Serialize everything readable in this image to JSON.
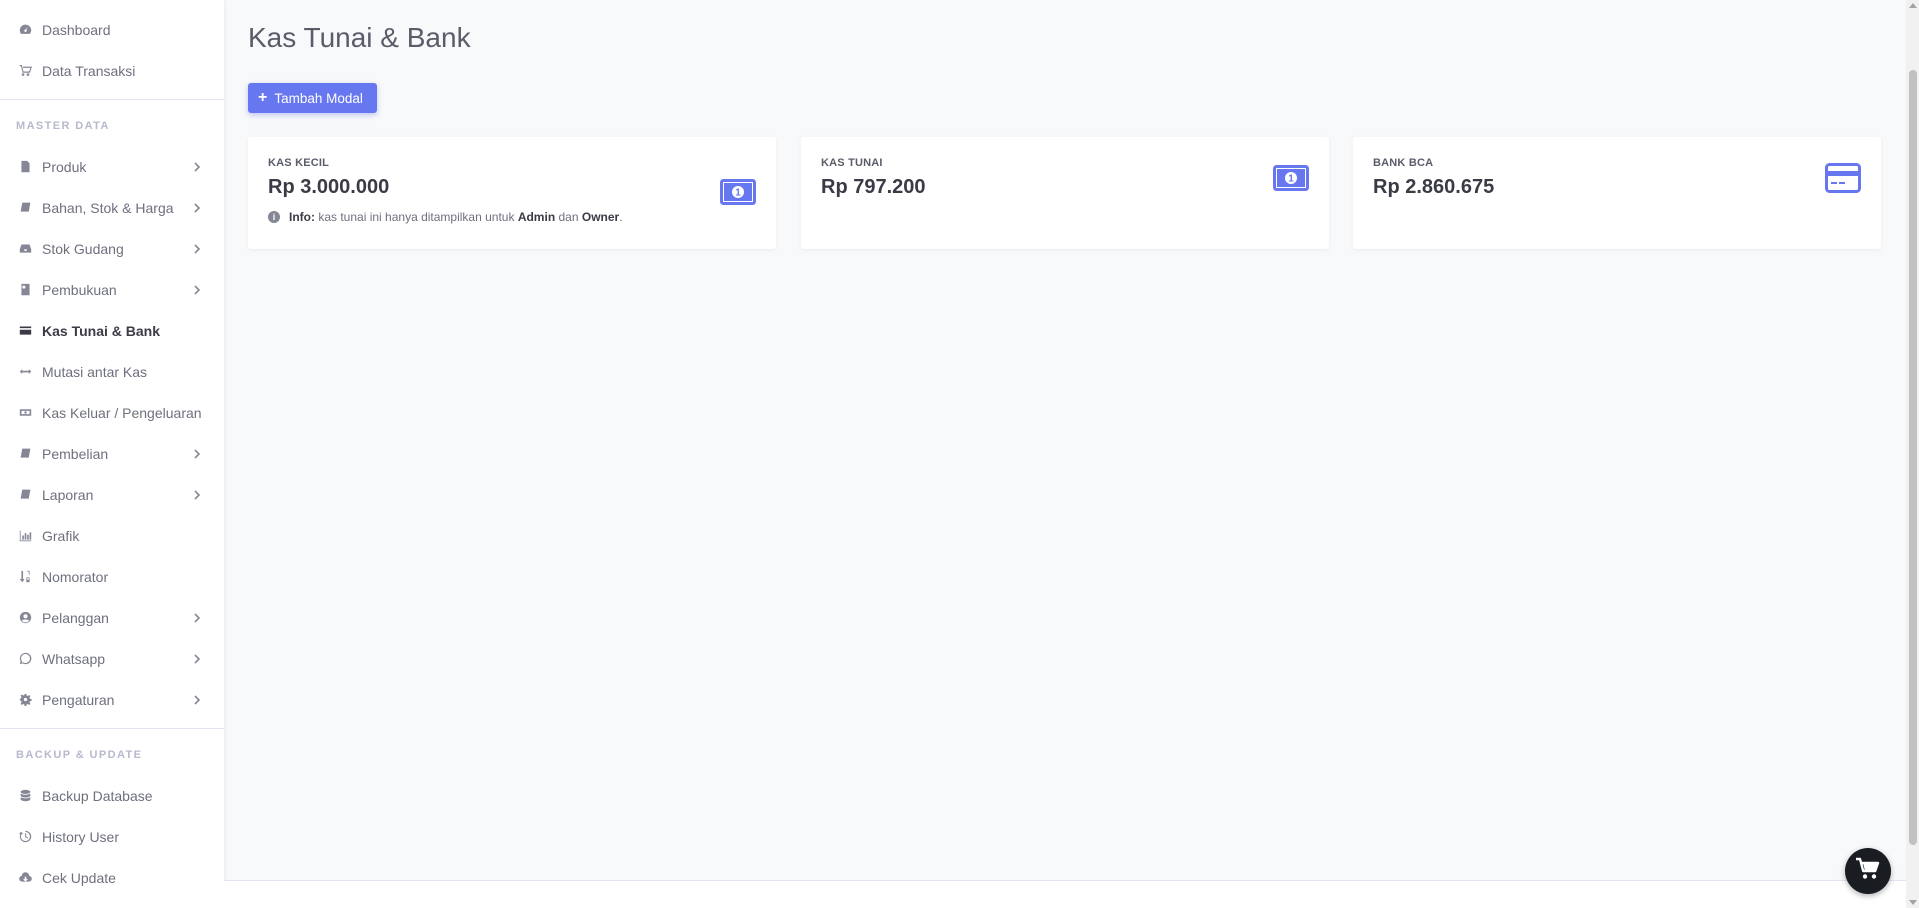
{
  "sidebar": {
    "top_items": [
      {
        "label": "Dashboard",
        "icon": "dashboard-icon"
      },
      {
        "label": "Data Transaksi",
        "icon": "cart-icon"
      }
    ],
    "master_heading": "MASTER DATA",
    "master_items": [
      {
        "label": "Produk",
        "icon": "file-icon",
        "has_sub": true
      },
      {
        "label": "Bahan, Stok & Harga",
        "icon": "book-icon",
        "has_sub": true
      },
      {
        "label": "Stok Gudang",
        "icon": "inbox-icon",
        "has_sub": true
      },
      {
        "label": "Pembukuan",
        "icon": "address-book-icon",
        "has_sub": true
      },
      {
        "label": "Kas Tunai & Bank",
        "icon": "credit-card-icon",
        "active": true
      },
      {
        "label": "Mutasi antar Kas",
        "icon": "arrows-h-icon"
      },
      {
        "label": "Kas Keluar / Pengeluaran",
        "icon": "money-icon"
      },
      {
        "label": "Pembelian",
        "icon": "book-icon",
        "has_sub": true
      },
      {
        "label": "Laporan",
        "icon": "book-icon",
        "has_sub": true
      },
      {
        "label": "Grafik",
        "icon": "bar-chart-icon"
      },
      {
        "label": "Nomorator",
        "icon": "sort-numeric-icon"
      },
      {
        "label": "Pelanggan",
        "icon": "user-circle-icon",
        "has_sub": true
      },
      {
        "label": "Whatsapp",
        "icon": "whatsapp-icon",
        "has_sub": true
      },
      {
        "label": "Pengaturan",
        "icon": "gear-icon",
        "has_sub": true
      }
    ],
    "backup_heading": "BACKUP & UPDATE",
    "backup_items": [
      {
        "label": "Backup Database",
        "icon": "database-icon"
      },
      {
        "label": "History User",
        "icon": "history-icon"
      },
      {
        "label": "Cek Update",
        "icon": "cloud-download-icon"
      }
    ]
  },
  "main": {
    "title": "Kas Tunai & Bank",
    "add_button": "Tambah Modal",
    "cards": [
      {
        "label": "KAS KECIL",
        "amount": "Rp 3.000.000",
        "icon": "money-bill-icon"
      },
      {
        "label": "KAS TUNAI",
        "amount": "Rp 797.200",
        "icon": "money-bill-icon"
      },
      {
        "label": "BANK BCA",
        "amount": "Rp 2.860.675",
        "icon": "credit-card-icon"
      }
    ],
    "info": {
      "prefix": "Info:",
      "text1": "kas tunai ini hanya ditampilkan untuk",
      "role1": "Admin",
      "text2": "dan",
      "role2": "Owner",
      "suffix": "."
    }
  },
  "colors": {
    "accent": "#6777ef",
    "sidebar_bg": "#ffffff",
    "content_bg": "#f8f9fa",
    "fab_bg": "#191d21"
  },
  "fab_icon": "shopping-cart-icon"
}
